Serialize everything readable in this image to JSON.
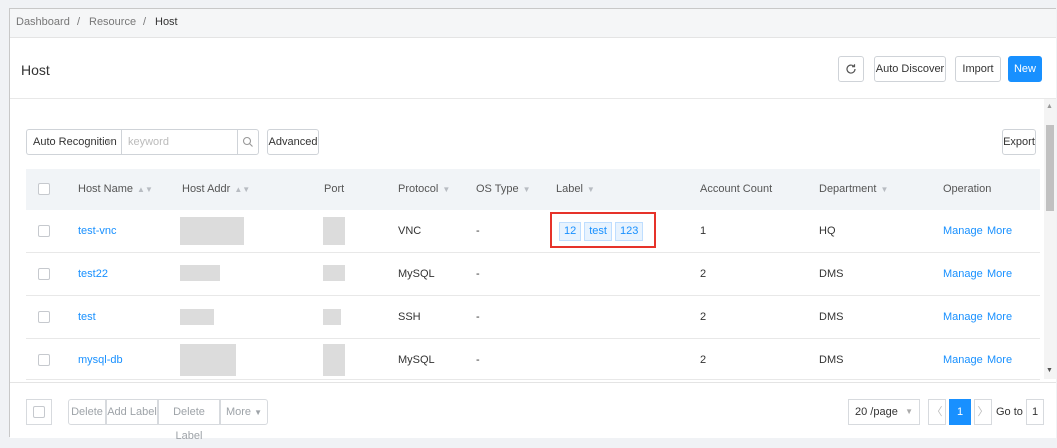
{
  "breadcrumb": [
    "Dashboard",
    "/",
    "Resource",
    "/",
    "Host"
  ],
  "page": {
    "title": "Host"
  },
  "header_buttons": {
    "refresh_icon": "refresh-icon",
    "auto_discover": "Auto Discover",
    "import": "Import",
    "new": "New"
  },
  "toolbar": {
    "select_value": "Auto Recognition",
    "keyword_placeholder": "keyword",
    "search_icon": "search-icon",
    "advanced": "Advanced",
    "export": "Export"
  },
  "table": {
    "columns": {
      "host_name": "Host Name",
      "host_addr": "Host Addr",
      "port": "Port",
      "protocol": "Protocol",
      "os_type": "OS Type",
      "label": "Label",
      "account_count": "Account Count",
      "department": "Department",
      "operation": "Operation"
    },
    "rows": [
      {
        "name": "test-vnc",
        "protocol": "VNC",
        "os_type": "-",
        "labels": [
          "12",
          "test",
          "123"
        ],
        "account_count": "1",
        "department": "HQ",
        "manage": "Manage",
        "more": "More"
      },
      {
        "name": "test22",
        "protocol": "MySQL",
        "os_type": "-",
        "labels": [],
        "account_count": "2",
        "department": "DMS",
        "manage": "Manage",
        "more": "More"
      },
      {
        "name": "test",
        "protocol": "SSH",
        "os_type": "-",
        "labels": [],
        "account_count": "2",
        "department": "DMS",
        "manage": "Manage",
        "more": "More"
      },
      {
        "name": "mysql-db",
        "protocol": "MySQL",
        "os_type": "-",
        "labels": [],
        "account_count": "2",
        "department": "DMS",
        "manage": "Manage",
        "more": "More"
      }
    ]
  },
  "footer": {
    "delete": "Delete",
    "add_label": "Add Label",
    "delete_label": "Delete Label",
    "more": "More",
    "page_size": "20 /page",
    "current_page": "1",
    "goto_label": "Go to",
    "goto_value": "1"
  },
  "colors": {
    "accent": "#1890ff",
    "highlight": "#e6332a"
  }
}
